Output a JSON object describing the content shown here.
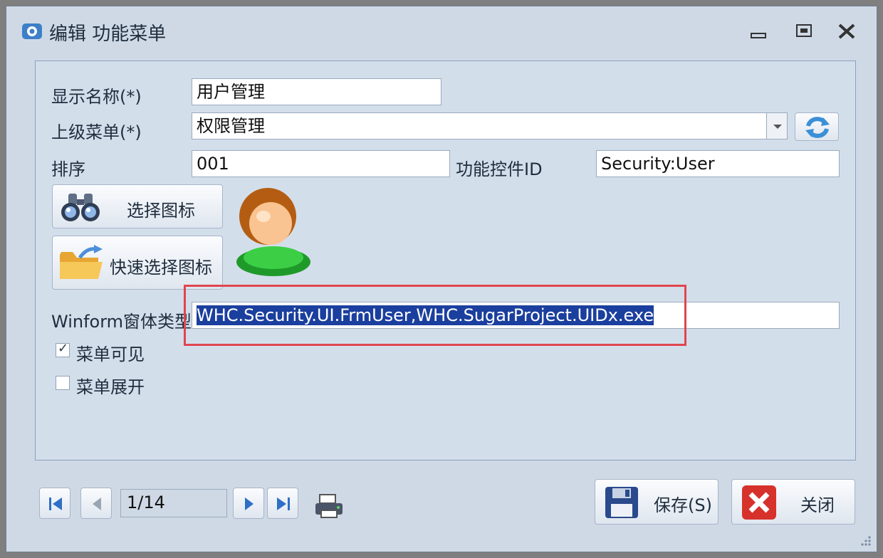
{
  "window": {
    "title": "编辑 功能菜单"
  },
  "form": {
    "display_name_label": "显示名称(*)",
    "display_name_value": "用户管理",
    "parent_menu_label": "上级菜单(*)",
    "parent_menu_value": "权限管理",
    "sort_label": "排序",
    "sort_value": "001",
    "control_id_label": "功能控件ID",
    "control_id_value": "Security:User",
    "choose_icon_label": "选择图标",
    "quick_choose_icon_label": "快速选择图标",
    "winform_type_label": "Winform窗体类型",
    "winform_type_value": "WHC.Security.UI.FrmUser,WHC.SugarProject.UIDx.exe",
    "menu_visible_label": "菜单可见",
    "menu_visible_checked": true,
    "menu_expand_label": "菜单展开",
    "menu_expand_checked": false
  },
  "footer": {
    "page_indicator": "1/14",
    "save_label": "保存(S)",
    "close_label": "关闭"
  },
  "colors": {
    "accent_red": "#e0464f",
    "selection_blue": "#1b3f9e"
  }
}
